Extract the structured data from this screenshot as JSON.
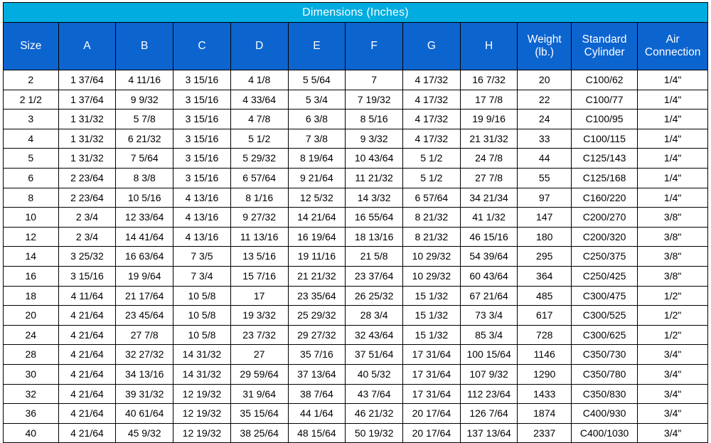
{
  "title": "Dimensions (Inches)",
  "columns": [
    {
      "key": "size",
      "label": "Size",
      "label2": ""
    },
    {
      "key": "a",
      "label": "A",
      "label2": ""
    },
    {
      "key": "b",
      "label": "B",
      "label2": ""
    },
    {
      "key": "c",
      "label": "C",
      "label2": ""
    },
    {
      "key": "d",
      "label": "D",
      "label2": ""
    },
    {
      "key": "e",
      "label": "E",
      "label2": ""
    },
    {
      "key": "f",
      "label": "F",
      "label2": ""
    },
    {
      "key": "g",
      "label": "G",
      "label2": ""
    },
    {
      "key": "h",
      "label": "H",
      "label2": ""
    },
    {
      "key": "weight",
      "label": "Weight",
      "label2": "(lb.)"
    },
    {
      "key": "cyl",
      "label": "Standard",
      "label2": "Cylinder"
    },
    {
      "key": "air",
      "label": "Air",
      "label2": "Connection"
    }
  ],
  "colors": {
    "title_band": "#00ace0",
    "header_band": "#0c64cf",
    "header_text": "#ffffff",
    "cell_bg": "#ffffff",
    "cell_text": "#000000",
    "border": "#000000"
  },
  "rows": [
    [
      "2",
      "1 37/64",
      "4 11/16",
      "3 15/16",
      "4 1/8",
      "5 5/64",
      "7",
      "4 17/32",
      "16 7/32",
      "20",
      "C100/62",
      "1/4\""
    ],
    [
      "2 1/2",
      "1 37/64",
      "9 9/32",
      "3 15/16",
      "4 33/64",
      "5 3/4",
      "7 19/32",
      "4 17/32",
      "17 7/8",
      "22",
      "C100/77",
      "1/4\""
    ],
    [
      "3",
      "1 31/32",
      "5 7/8",
      "3 15/16",
      "4 7/8",
      "6 3/8",
      "8 5/16",
      "4 17/32",
      "19 9/16",
      "24",
      "C100/95",
      "1/4\""
    ],
    [
      "4",
      "1 31/32",
      "6 21/32",
      "3 15/16",
      "5 1/2",
      "7 3/8",
      "9 3/32",
      "4 17/32",
      "21 31/32",
      "33",
      "C100/115",
      "1/4\""
    ],
    [
      "5",
      "1 31/32",
      "7 5/64",
      "3 15/16",
      "5 29/32",
      "8 19/64",
      "10 43/64",
      "5 1/2",
      "24 7/8",
      "44",
      "C125/143",
      "1/4\""
    ],
    [
      "6",
      "2 23/64",
      "8 3/8",
      "3 15/16",
      "6 57/64",
      "9 21/64",
      "11 21/32",
      "5 1/2",
      "27 7/8",
      "55",
      "C125/168",
      "1/4\""
    ],
    [
      "8",
      "2 23/64",
      "10 5/16",
      "4 13/16",
      "8 1/16",
      "12 5/32",
      "14 3/32",
      "6 57/64",
      "34 21/34",
      "97",
      "C160/220",
      "1/4\""
    ],
    [
      "10",
      "2 3/4",
      "12 33/64",
      "4 13/16",
      "9 27/32",
      "14 21/64",
      "16 55/64",
      "8 21/32",
      "41 1/32",
      "147",
      "C200/270",
      "3/8\""
    ],
    [
      "12",
      "2 3/4",
      "14 41/64",
      "4 13/16",
      "11 13/16",
      "16 19/64",
      "18 13/16",
      "8 21/32",
      "46 15/16",
      "180",
      "C200/320",
      "3/8\""
    ],
    [
      "14",
      "3 25/32",
      "16 63/64",
      "7 3/5",
      "13 5/16",
      "19 11/16",
      "21 5/8",
      "10 29/32",
      "54 39/64",
      "295",
      "C250/375",
      "3/8\""
    ],
    [
      "16",
      "3 15/16",
      "19 9/64",
      "7 3/4",
      "15 7/16",
      "21 21/32",
      "23 37/64",
      "10 29/32",
      "60 43/64",
      "364",
      "C250/425",
      "3/8\""
    ],
    [
      "18",
      "4 11/64",
      "21 17/64",
      "10 5/8",
      "17",
      "23 35/64",
      "26 25/32",
      "15 1/32",
      "67 21/64",
      "485",
      "C300/475",
      "1/2\""
    ],
    [
      "20",
      "4 21/64",
      "23 45/64",
      "10 5/8",
      "19 3/32",
      "25 29/32",
      "28 3/4",
      "15 1/32",
      "73 3/4",
      "617",
      "C300/525",
      "1/2\""
    ],
    [
      "24",
      "4 21/64",
      "27 7/8",
      "10 5/8",
      "23 7/32",
      "29 27/32",
      "32 43/64",
      "15 1/32",
      "85 3/4",
      "728",
      "C300/625",
      "1/2\""
    ],
    [
      "28",
      "4 21/64",
      "32 27/32",
      "14 31/32",
      "27",
      "35 7/16",
      "37 51/64",
      "17 31/64",
      "100 15/64",
      "1146",
      "C350/730",
      "3/4\""
    ],
    [
      "30",
      "4 21/64",
      "34 13/16",
      "14 31/32",
      "29 59/64",
      "37 13/64",
      "40 5/32",
      "17 31/64",
      "107 9/32",
      "1290",
      "C350/780",
      "3/4\""
    ],
    [
      "32",
      "4 21/64",
      "39 31/32",
      "12 19/32",
      "31 9/64",
      "38 7/64",
      "43 7/64",
      "17 31/64",
      "112 23/64",
      "1433",
      "C350/830",
      "3/4\""
    ],
    [
      "36",
      "4 21/64",
      "40 61/64",
      "12 19/32",
      "35 15/64",
      "44 1/64",
      "46 21/32",
      "20 17/64",
      "126 7/64",
      "1874",
      "C400/930",
      "3/4\""
    ],
    [
      "40",
      "4 21/64",
      "45 9/32",
      "12 19/32",
      "38 25/64",
      "48 15/64",
      "50 19/32",
      "20 17/64",
      "137 13/64",
      "2337",
      "C400/1030",
      "3/4\""
    ]
  ]
}
